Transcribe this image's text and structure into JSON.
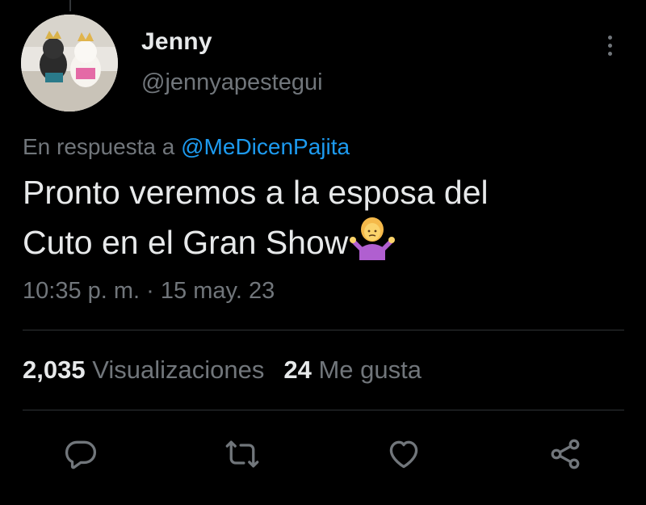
{
  "author": {
    "name": "Jenny",
    "handle": "@jennyapestegui"
  },
  "tweet": {
    "reply_prefix": "En respuesta a",
    "reply_to": "@MeDicenPajita",
    "text_line1": "Pronto veremos a la esposa del",
    "text_line2": "Cuto en el Gran Show",
    "emoji": "person-shrugging-emoji",
    "time": "10:35 p. m.",
    "separator": "·",
    "date": "15 may. 23"
  },
  "stats": {
    "views_count": "2,035",
    "views_label": "Visualizaciones",
    "likes_count": "24",
    "likes_label": "Me gusta"
  },
  "icons": {
    "more": "more-vertical-icon",
    "reply": "reply-icon",
    "retweet": "retweet-icon",
    "like": "heart-icon",
    "share": "share-icon"
  },
  "colors": {
    "background": "#000000",
    "text": "#e7e9ea",
    "secondary": "#71767b",
    "link": "#1d9bf0",
    "divider": "#2f3336"
  }
}
